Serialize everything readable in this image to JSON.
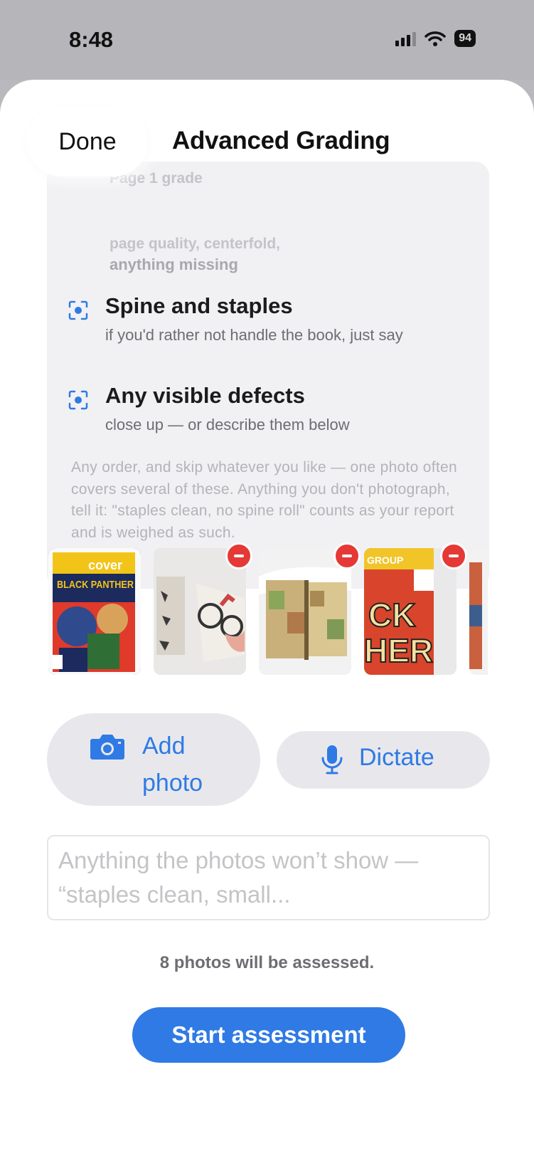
{
  "status": {
    "time": "8:48",
    "battery": "94"
  },
  "header": {
    "done_label": "Done",
    "title": "Advanced Grading"
  },
  "checklist": {
    "ghost_line_1": "Page 1 grade",
    "ghost_line_2": "page quality, centerfold,",
    "ghost_line_3": "anything missing",
    "items": [
      {
        "title": "Spine and staples",
        "subtitle": "if you'd rather not handle the book, just say",
        "icon": "viewfinder-icon"
      },
      {
        "title": "Any visible defects",
        "subtitle": "close up — or describe them below",
        "icon": "viewfinder-icon"
      }
    ],
    "note": "Any order, and skip whatever you like — one photo often covers several of these. Anything you don't photograph, tell it: \"staples clean, no spine roll\" counts as your report and is weighed as such."
  },
  "photos": {
    "cover_label": "cover",
    "cover_title": "BLACK PANTHER",
    "thumb4_text_1": "GROUP",
    "thumb4_text_2": "CK",
    "thumb4_text_3": "HER"
  },
  "actions": {
    "add_photo_label": "Add photo",
    "dictate_label": "Dictate"
  },
  "notes": {
    "placeholder": "Anything the photos won’t show — “staples clean, small..."
  },
  "footer": {
    "count_text": "8 photos will be assessed.",
    "start_label": "Start assessment"
  },
  "colors": {
    "accent": "#2f7ae5",
    "delete": "#e53935"
  }
}
